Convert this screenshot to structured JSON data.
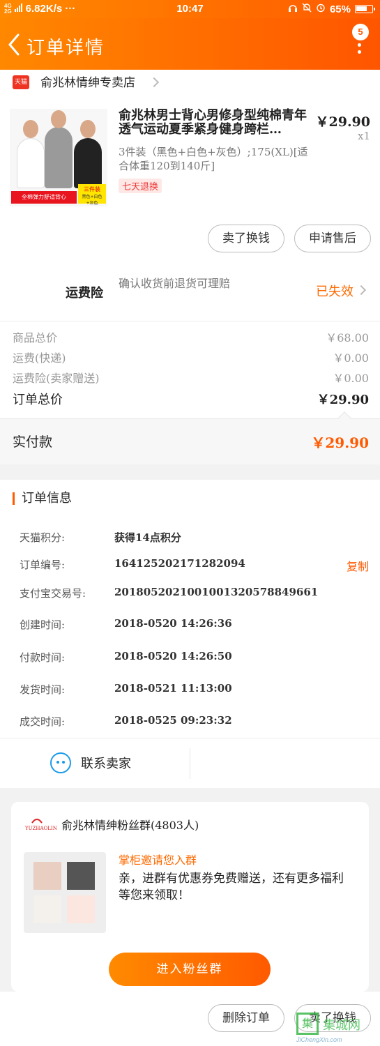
{
  "status_bar": {
    "network_type": "4G",
    "network_type2": "2G",
    "speed": "6.82K/s ···",
    "time": "10:47",
    "battery": "65%"
  },
  "header": {
    "title": "订单详情",
    "badge_count": "5"
  },
  "shop": {
    "tag": "天猫",
    "name": "俞兆林情绅专卖店"
  },
  "product": {
    "title": "俞兆林男士背心男修身型纯棉青年透气运动夏季紧身健身跨栏…",
    "price": "￥29.90",
    "quantity": "x1",
    "sku": "3件装（黑色+白色+灰色）;175(XL)[适合体重120到140斤]",
    "tag": "七天退换",
    "promo_text": "全棉弹力舒适背心",
    "pack_text": "三件装",
    "pack_sub": "黑色+白色+灰色"
  },
  "actions": {
    "buy_again": "卖了换钱",
    "after_sale": "申请售后"
  },
  "insurance": {
    "label": "运费险",
    "description": "确认收货前退货可理赔",
    "status": "已失效"
  },
  "summary": {
    "goods_total_label": "商品总价",
    "goods_total": "￥68.00",
    "shipping_label": "运费(快递)",
    "shipping": "￥0.00",
    "insurance_label": "运费险(卖家赠送)",
    "insurance": "￥0.00",
    "order_total_label": "订单总价",
    "order_total": "￥29.90"
  },
  "paid": {
    "label": "实付款",
    "value": "￥29.90"
  },
  "order_info": {
    "title": "订单信息",
    "rows": [
      {
        "label": "天猫积分:",
        "value": "获得14点积分"
      },
      {
        "label": "订单编号:",
        "value": "164125202171282094"
      },
      {
        "label": "支付宝交易号:",
        "value": "2018052021001001320578849661"
      },
      {
        "label": "创建时间:",
        "value": "2018-0520 14:26:36"
      },
      {
        "label": "付款时间:",
        "value": "2018-0520 14:26:50"
      },
      {
        "label": "发货时间:",
        "value": "2018-0521 11:13:00"
      },
      {
        "label": "成交时间:",
        "value": "2018-0525 09:23:32"
      }
    ],
    "copy_label": "复制"
  },
  "contact": {
    "label": "联系卖家"
  },
  "fan_group": {
    "logo_text": "YUZHAOLIN",
    "name": "俞兆林情绅粉丝群(4803人)",
    "subtitle": "掌柜邀请您入群",
    "message": "亲，进群有优惠券免费赠送，还有更多福利等您来领取！",
    "join_button": "进入粉丝群"
  },
  "footer": {
    "delete_order": "删除订单",
    "buy_again": "卖了换钱"
  },
  "watermark": {
    "box_char": "集",
    "text": "集城网",
    "url": "JiChengXin.com"
  },
  "colors": {
    "accent": "#ff5a00",
    "header_start": "#ff8800",
    "link_blue": "#1a9be8"
  }
}
